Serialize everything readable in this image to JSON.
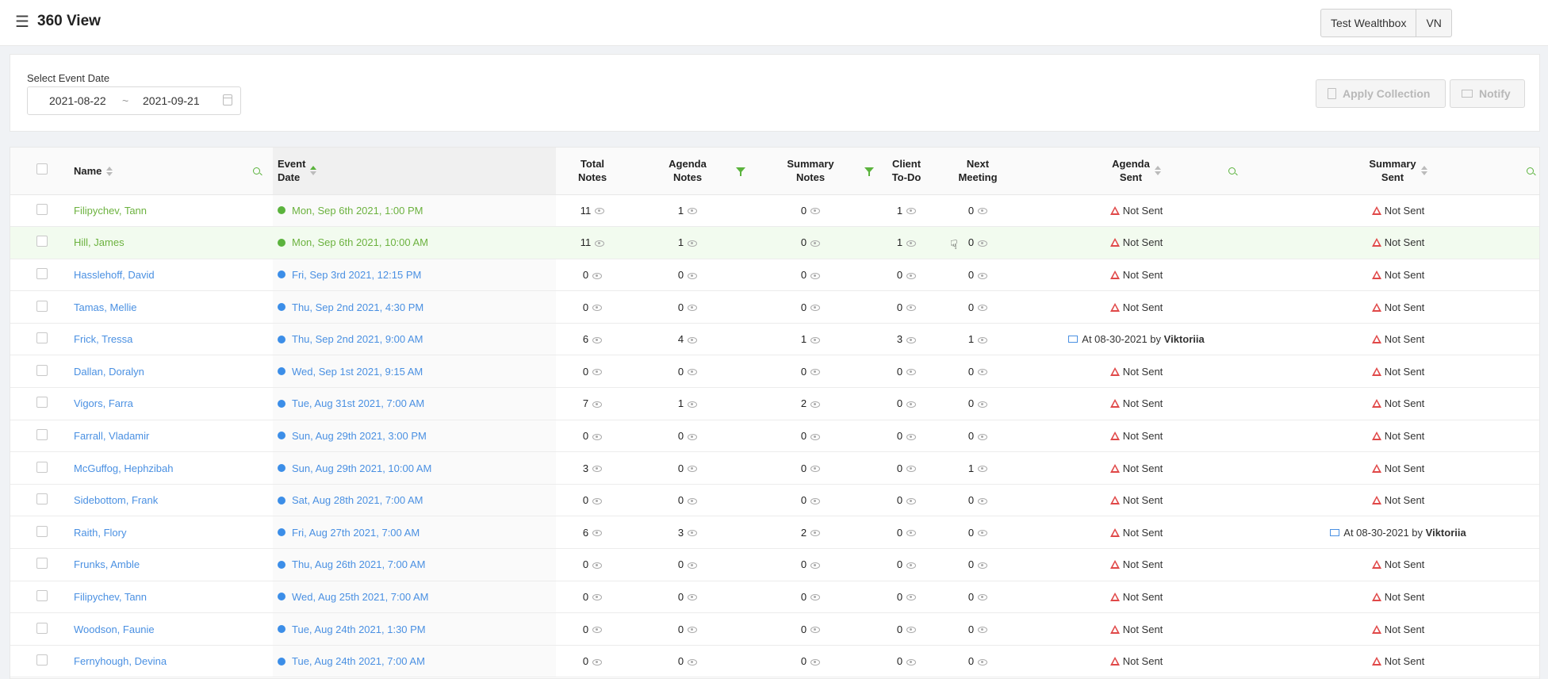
{
  "header": {
    "title": "360 View",
    "menu_icon": "hamburger-icon",
    "buttons": [
      "Test Wealthbox",
      "VN"
    ]
  },
  "filter": {
    "label": "Select Event Date",
    "date_start": "2021-08-22",
    "date_separator": "~",
    "date_end": "2021-09-21",
    "apply_label": "Apply Collection",
    "notify_label": "Notify"
  },
  "table": {
    "columns": {
      "name": "Name",
      "event_date": [
        "Event",
        "Date"
      ],
      "total_notes": [
        "Total",
        "Notes"
      ],
      "agenda_notes": [
        "Agenda",
        "Notes"
      ],
      "summary_notes": [
        "Summary",
        "Notes"
      ],
      "client_todo": [
        "Client",
        "To-Do"
      ],
      "next_meeting": [
        "Next",
        "Meeting"
      ],
      "agenda_sent": [
        "Agenda",
        "Sent"
      ],
      "summary_sent": [
        "Summary",
        "Sent"
      ]
    },
    "rows": [
      {
        "name": "Filipychev, Tann",
        "event": "Mon, Sep 6th 2021, 1:00 PM",
        "status": "green",
        "total": "11",
        "agenda": "1",
        "summary": "0",
        "todo": "1",
        "next": "0",
        "agenda_sent": "Not Sent",
        "summary_sent": "Not Sent"
      },
      {
        "name": "Hill, James",
        "event": "Mon, Sep 6th 2021, 10:00 AM",
        "status": "green",
        "total": "11",
        "agenda": "1",
        "summary": "0",
        "todo": "1",
        "next": "0",
        "agenda_sent": "Not Sent",
        "summary_sent": "Not Sent"
      },
      {
        "name": "Hasslehoff, David",
        "event": "Fri, Sep 3rd 2021, 12:15 PM",
        "status": "blue",
        "total": "0",
        "agenda": "0",
        "summary": "0",
        "todo": "0",
        "next": "0",
        "agenda_sent": "Not Sent",
        "summary_sent": "Not Sent"
      },
      {
        "name": "Tamas, Mellie",
        "event": "Thu, Sep 2nd 2021, 4:30 PM",
        "status": "blue",
        "total": "0",
        "agenda": "0",
        "summary": "0",
        "todo": "0",
        "next": "0",
        "agenda_sent": "Not Sent",
        "summary_sent": "Not Sent"
      },
      {
        "name": "Frick, Tressa",
        "event": "Thu, Sep 2nd 2021, 9:00 AM",
        "status": "blue",
        "total": "6",
        "agenda": "4",
        "summary": "1",
        "todo": "3",
        "next": "1",
        "agenda_sent": "At 08-30-2021 by",
        "agenda_sent_by": "Viktoriia",
        "summary_sent": "Not Sent"
      },
      {
        "name": "Dallan, Doralyn",
        "event": "Wed, Sep 1st 2021, 9:15 AM",
        "status": "blue",
        "total": "0",
        "agenda": "0",
        "summary": "0",
        "todo": "0",
        "next": "0",
        "agenda_sent": "Not Sent",
        "summary_sent": "Not Sent"
      },
      {
        "name": "Vigors, Farra",
        "event": "Tue, Aug 31st 2021, 7:00 AM",
        "status": "blue",
        "total": "7",
        "agenda": "1",
        "summary": "2",
        "todo": "0",
        "next": "0",
        "agenda_sent": "Not Sent",
        "summary_sent": "Not Sent"
      },
      {
        "name": "Farrall, Vladamir",
        "event": "Sun, Aug 29th 2021, 3:00 PM",
        "status": "blue",
        "total": "0",
        "agenda": "0",
        "summary": "0",
        "todo": "0",
        "next": "0",
        "agenda_sent": "Not Sent",
        "summary_sent": "Not Sent"
      },
      {
        "name": "McGuffog, Hephzibah",
        "event": "Sun, Aug 29th 2021, 10:00 AM",
        "status": "blue",
        "total": "3",
        "agenda": "0",
        "summary": "0",
        "todo": "0",
        "next": "1",
        "agenda_sent": "Not Sent",
        "summary_sent": "Not Sent"
      },
      {
        "name": "Sidebottom, Frank",
        "event": "Sat, Aug 28th 2021, 7:00 AM",
        "status": "blue",
        "total": "0",
        "agenda": "0",
        "summary": "0",
        "todo": "0",
        "next": "0",
        "agenda_sent": "Not Sent",
        "summary_sent": "Not Sent"
      },
      {
        "name": "Raith, Flory",
        "event": "Fri, Aug 27th 2021, 7:00 AM",
        "status": "blue",
        "total": "6",
        "agenda": "3",
        "summary": "2",
        "todo": "0",
        "next": "0",
        "agenda_sent": "Not Sent",
        "summary_sent": "At 08-30-2021 by",
        "summary_sent_by": "Viktoriia"
      },
      {
        "name": "Frunks, Amble",
        "event": "Thu, Aug 26th 2021, 7:00 AM",
        "status": "blue",
        "total": "0",
        "agenda": "0",
        "summary": "0",
        "todo": "0",
        "next": "0",
        "agenda_sent": "Not Sent",
        "summary_sent": "Not Sent"
      },
      {
        "name": "Filipychev, Tann",
        "event": "Wed, Aug 25th 2021, 7:00 AM",
        "status": "blue",
        "total": "0",
        "agenda": "0",
        "summary": "0",
        "todo": "0",
        "next": "0",
        "agenda_sent": "Not Sent",
        "summary_sent": "Not Sent"
      },
      {
        "name": "Woodson, Faunie",
        "event": "Tue, Aug 24th 2021, 1:30 PM",
        "status": "blue",
        "total": "0",
        "agenda": "0",
        "summary": "0",
        "todo": "0",
        "next": "0",
        "agenda_sent": "Not Sent",
        "summary_sent": "Not Sent"
      },
      {
        "name": "Fernyhough, Devina",
        "event": "Tue, Aug 24th 2021, 7:00 AM",
        "status": "blue",
        "total": "0",
        "agenda": "0",
        "summary": "0",
        "todo": "0",
        "next": "0",
        "agenda_sent": "Not Sent",
        "summary_sent": "Not Sent"
      }
    ]
  },
  "colors": {
    "accent_green": "#5bb33d",
    "link_blue": "#4a90e2",
    "warning_red": "#e04848"
  }
}
